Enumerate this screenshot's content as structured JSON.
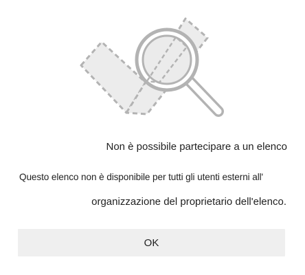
{
  "dialog": {
    "illustration_icon": "empty-list-magnifier-illustration",
    "title": "Non è possibile partecipare a un elenco",
    "message_line1": "Questo elenco non è disponibile per tutti gli utenti esterni all'",
    "message_line2": "organizzazione del proprietario dell'elenco.",
    "ok_label": "OK"
  },
  "colors": {
    "background": "#ffffff",
    "button_background": "#efefef",
    "text": "#1f1f1f",
    "illustration_fill": "#ededed",
    "illustration_stroke": "#b3b3b3"
  }
}
